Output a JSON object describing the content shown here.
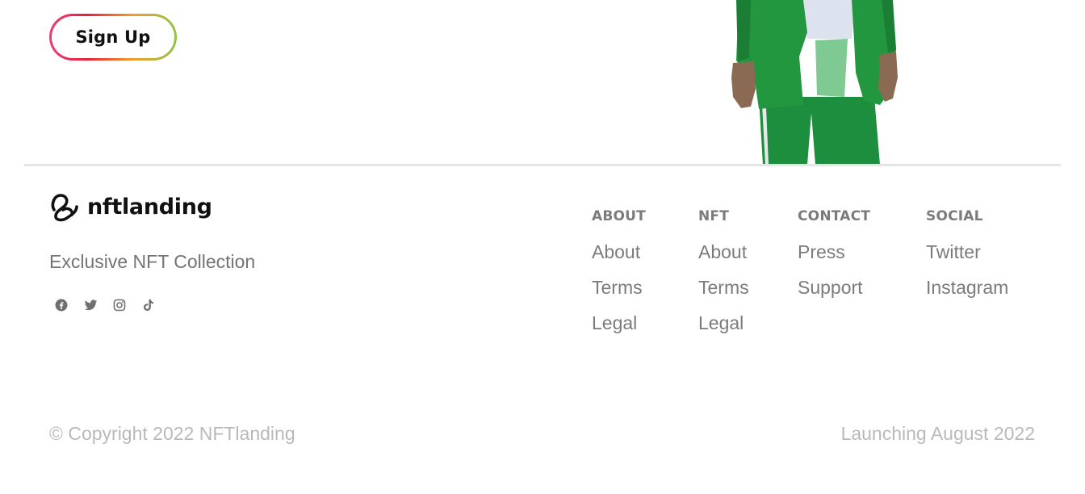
{
  "hero": {
    "signup_label": "Sign Up"
  },
  "footer": {
    "brand_name": "nftlanding",
    "tagline": "Exclusive NFT Collection",
    "social_icons": [
      "facebook-icon",
      "twitter-icon",
      "instagram-icon",
      "tiktok-icon"
    ],
    "columns": [
      {
        "heading": "ABOUT",
        "links": [
          "About",
          "Terms",
          "Legal"
        ]
      },
      {
        "heading": "NFT",
        "links": [
          "About",
          "Terms",
          "Legal"
        ]
      },
      {
        "heading": "CONTACT",
        "links": [
          "Press",
          "Support"
        ]
      },
      {
        "heading": "SOCIAL",
        "links": [
          "Twitter",
          "Instagram"
        ]
      }
    ],
    "copyright": "© Copyright 2022 NFTlanding",
    "launching": "Launching August 2022"
  },
  "colors": {
    "link_gray": "#7b7b7b",
    "muted_gray": "#b9b9b9",
    "gradient": [
      "#ef3b73",
      "#e5223a",
      "#f19d2b",
      "#8fc54a"
    ]
  }
}
